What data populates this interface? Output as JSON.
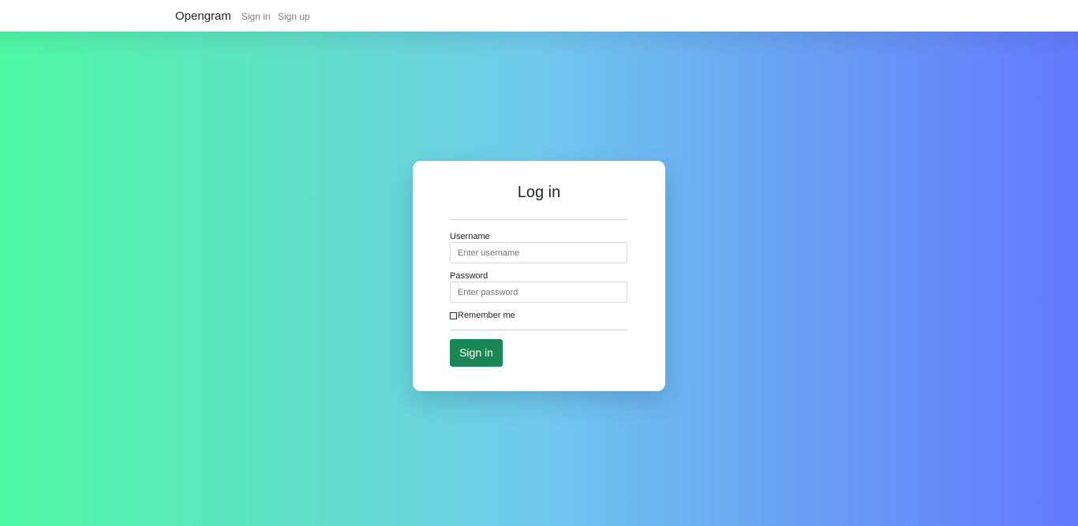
{
  "navbar": {
    "brand": "Opengram",
    "links": [
      {
        "label": "Sign in"
      },
      {
        "label": "Sign up"
      }
    ]
  },
  "login_card": {
    "title": "Log in",
    "username": {
      "label": "Username",
      "placeholder": "Enter username",
      "value": ""
    },
    "password": {
      "label": "Password",
      "placeholder": "Enter password",
      "value": ""
    },
    "remember_me": {
      "label": "Remember me",
      "checked": false
    },
    "submit_label": "Sign in"
  },
  "colors": {
    "gradient_start": "#4ff9a5",
    "gradient_mid": "#71c9ee",
    "gradient_end": "#6478fe",
    "submit_button": "#198754"
  }
}
